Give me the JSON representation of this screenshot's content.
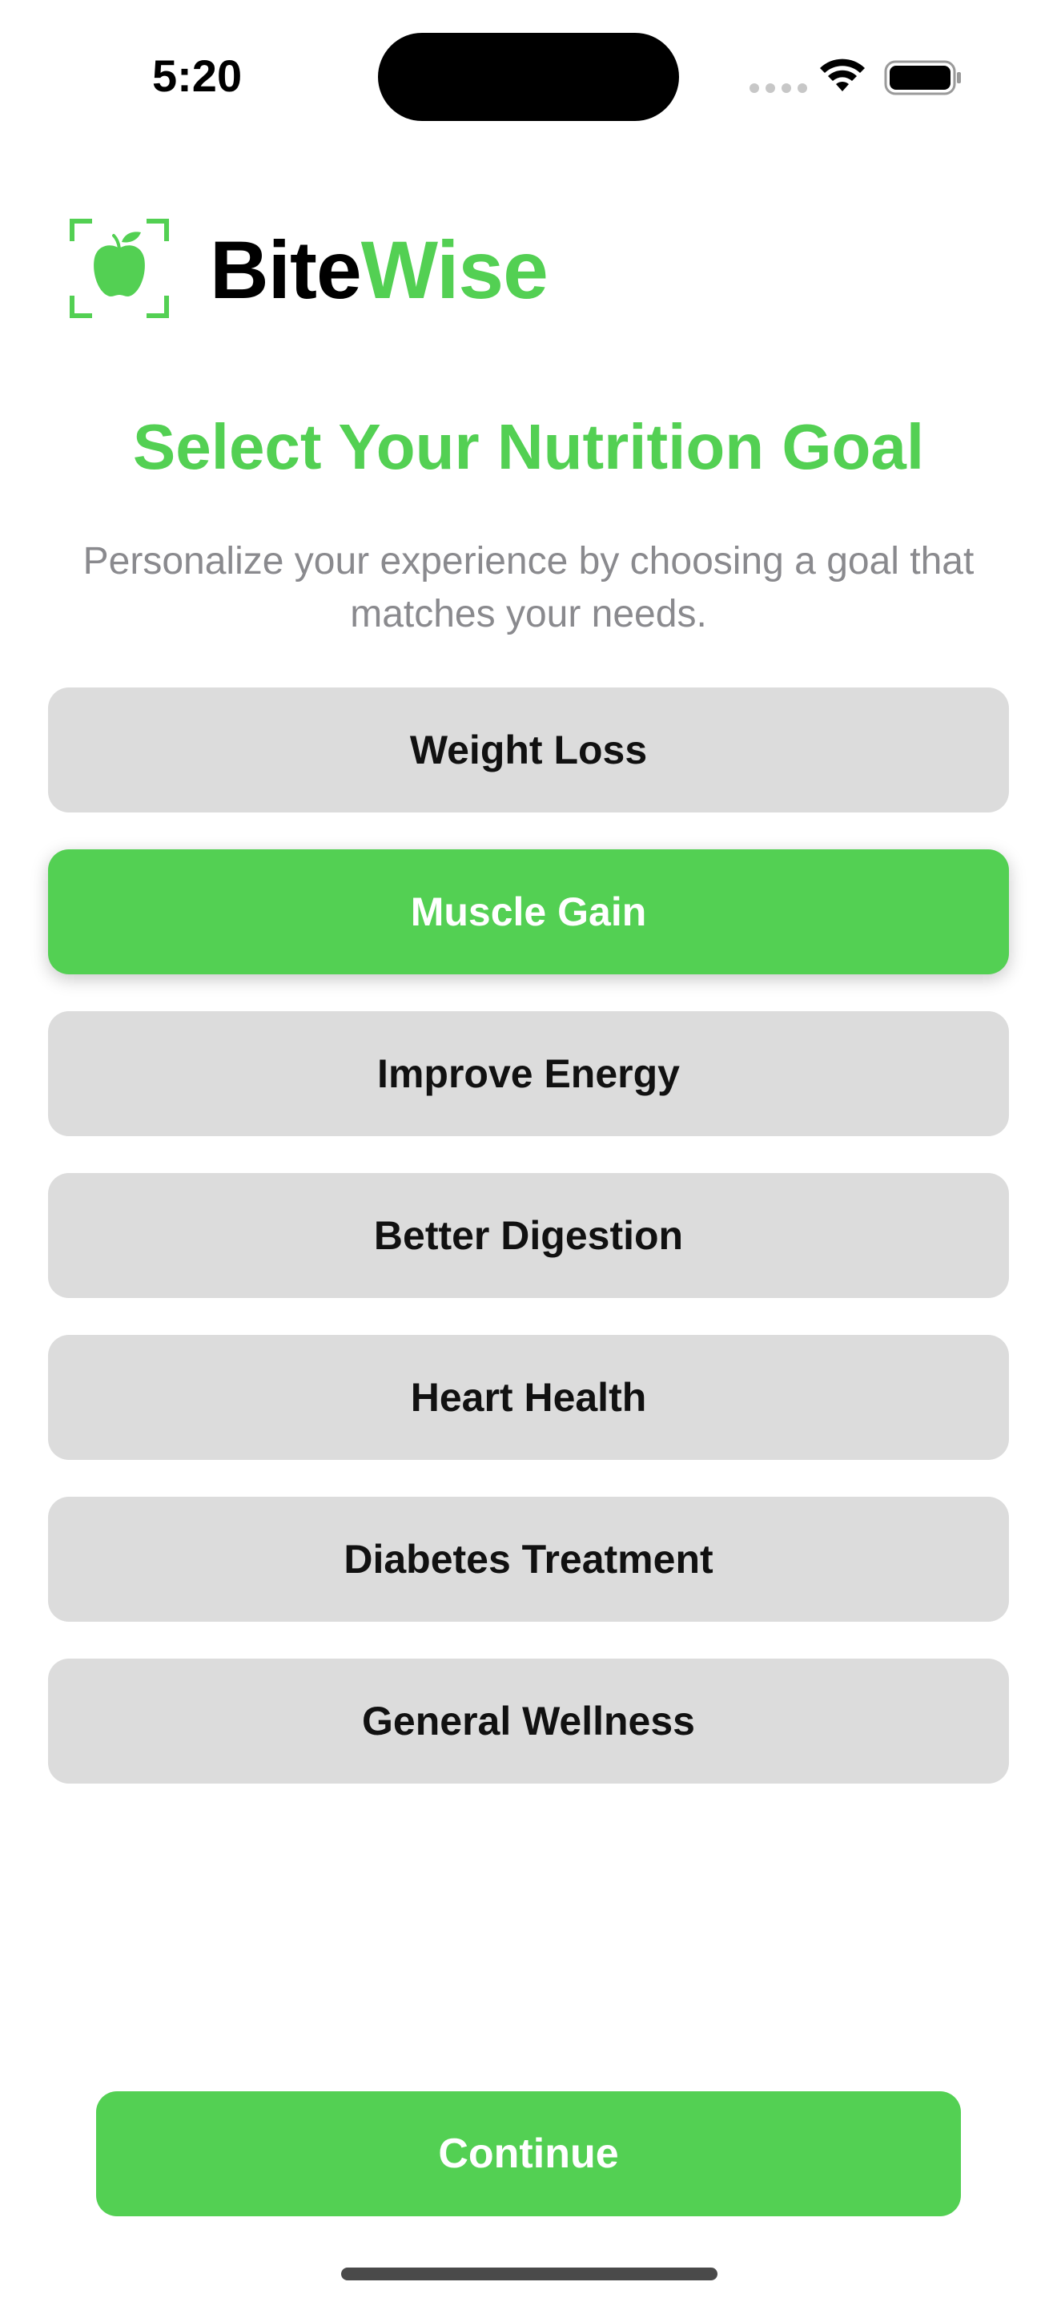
{
  "status_bar": {
    "time": "5:20"
  },
  "brand": {
    "name_part_a": "Bite",
    "name_part_b": "Wise",
    "accent_color": "#53d053",
    "logo_icon": "apple-scan-icon"
  },
  "header": {
    "title": "Select Your Nutrition Goal",
    "subtitle": "Personalize your experience by choosing a goal that matches your needs."
  },
  "goals": {
    "options": [
      {
        "label": "Weight Loss",
        "selected": false
      },
      {
        "label": "Muscle Gain",
        "selected": true
      },
      {
        "label": "Improve Energy",
        "selected": false
      },
      {
        "label": "Better Digestion",
        "selected": false
      },
      {
        "label": "Heart Health",
        "selected": false
      },
      {
        "label": "Diabetes Treatment",
        "selected": false
      },
      {
        "label": "General Wellness",
        "selected": false
      }
    ]
  },
  "footer": {
    "continue_label": "Continue"
  },
  "colors": {
    "accent": "#53d053",
    "option_bg": "#dcdcdc",
    "subtitle_text": "#8a8a8e"
  }
}
